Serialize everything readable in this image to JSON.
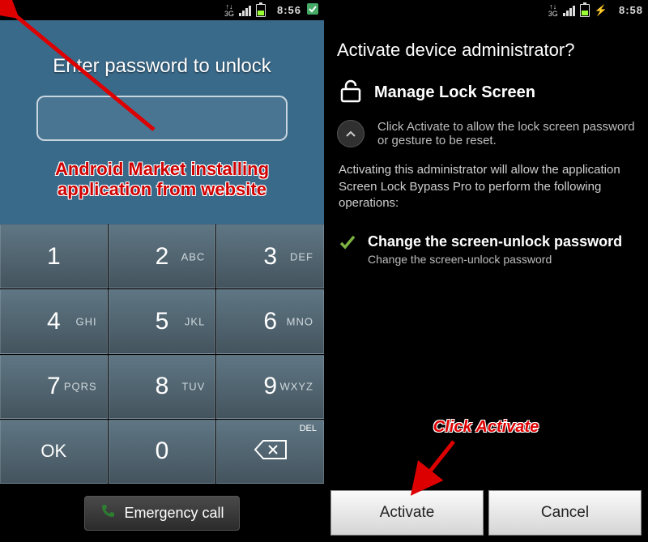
{
  "left_status": {
    "time": "8:56",
    "net": "3G"
  },
  "right_status": {
    "time": "8:58",
    "net": "3G"
  },
  "lock": {
    "title": "Enter password to unlock",
    "annotation_line1": "Android Market installing",
    "annotation_line2": "application from website",
    "keys": [
      {
        "d": "1",
        "l": ""
      },
      {
        "d": "2",
        "l": "ABC"
      },
      {
        "d": "3",
        "l": "DEF"
      },
      {
        "d": "4",
        "l": "GHI"
      },
      {
        "d": "5",
        "l": "JKL"
      },
      {
        "d": "6",
        "l": "MNO"
      },
      {
        "d": "7",
        "l": "PQRS"
      },
      {
        "d": "8",
        "l": "TUV"
      },
      {
        "d": "9",
        "l": "WXYZ"
      }
    ],
    "ok": "OK",
    "zero": "0",
    "del": "DEL",
    "emergency": "Emergency call"
  },
  "admin": {
    "title": "Activate device administrator?",
    "app_name": "Manage Lock Screen",
    "desc": "Click Activate to allow the lock screen password or gesture to be reset.",
    "body": "Activating this administrator will allow the application Screen Lock Bypass Pro to perform the following operations:",
    "perm_title": "Change the screen-unlock password",
    "perm_sub": "Change the screen-unlock password",
    "click_activate": "Click Activate",
    "activate": "Activate",
    "cancel": "Cancel"
  }
}
